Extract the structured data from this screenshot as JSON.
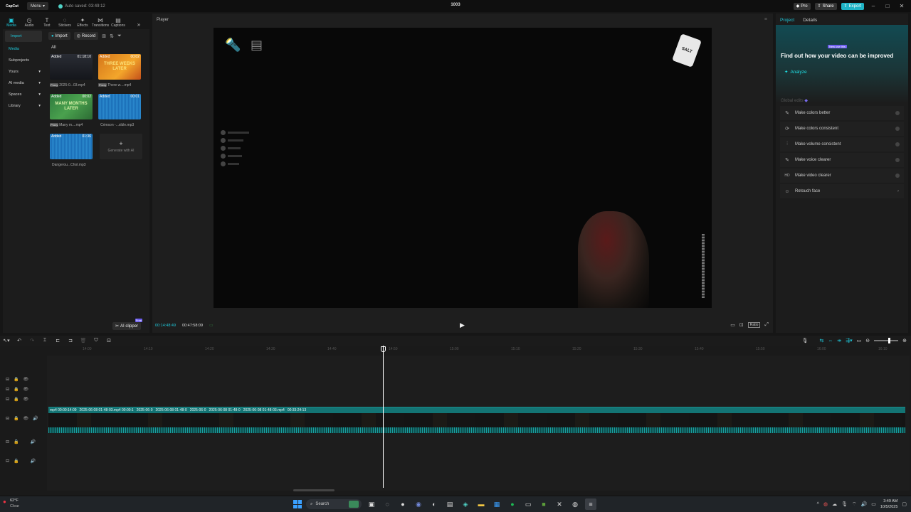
{
  "titlebar": {
    "logo": "CapCut",
    "menu_label": "Menu",
    "autosave": "Auto saved: 03:49:12",
    "project_name": "1003",
    "pro_label": "Pro",
    "share_label": "Share",
    "export_label": "Export"
  },
  "left_tabs": [
    {
      "label": "Media",
      "icon": "▣"
    },
    {
      "label": "Audio",
      "icon": "◷"
    },
    {
      "label": "Text",
      "icon": "T"
    },
    {
      "label": "Stickers",
      "icon": "◌"
    },
    {
      "label": "Effects",
      "icon": "✦"
    },
    {
      "label": "Transitions",
      "icon": "⋈"
    },
    {
      "label": "Captions",
      "icon": "▤"
    }
  ],
  "media": {
    "side_nav": {
      "import": "Import",
      "media": "Media",
      "subprojects": "Subprojects",
      "yours": "Yours",
      "ai_media": "AI media",
      "spaces": "Spaces",
      "library": "Library"
    },
    "import_btn": "Import",
    "record_btn": "Record",
    "all_label": "All",
    "clips": [
      {
        "tag": "Added",
        "duration": "01:18:10",
        "name": "2025-0...03.mp4",
        "badge": "Proxy"
      },
      {
        "tag": "Added",
        "duration": "00:02",
        "name": "There w....mp4",
        "badge": "Proxy",
        "thumb_text": "THREE WEEKS LATER"
      },
      {
        "tag": "Added",
        "duration": "00:02",
        "name": "Many m....mp4",
        "badge": "Proxy",
        "thumb_text": "MANY MONTHS LATER"
      },
      {
        "tag": "Added",
        "duration": "00:01",
        "name": "Crimson -...xible.mp3",
        "badge": ""
      },
      {
        "tag": "Added",
        "duration": "01:36",
        "name": "Dangerou...Chol.mp3",
        "badge": ""
      }
    ],
    "generate_ai": "Generate with AI",
    "ai_clipper": "AI clipper",
    "ai_clipper_badge": "Free"
  },
  "player": {
    "label": "Player",
    "current_time": "00:14:48:49",
    "total_time": "00:47:58:09",
    "ratio_label": "Ratio",
    "salt_label": "SALT"
  },
  "right_panel": {
    "tab_project": "Project",
    "tab_details": "Details",
    "badge": "New use this",
    "hero_text": "Find out how your video can be improved",
    "analyze": "Analyze",
    "global_edits": "Global edits",
    "items": [
      {
        "label": "Make colors better",
        "icon": "✎",
        "type": "toggle"
      },
      {
        "label": "Make colors consistent",
        "icon": "⟳",
        "type": "toggle"
      },
      {
        "label": "Make volume consistent",
        "icon": "⫶",
        "type": "toggle"
      },
      {
        "label": "Make voice clearer",
        "icon": "✎",
        "type": "toggle"
      },
      {
        "label": "Make video clearer",
        "icon": "HD",
        "type": "toggle"
      },
      {
        "label": "Retouch face",
        "icon": "☺",
        "type": "chevron"
      }
    ]
  },
  "timeline": {
    "ruler_ticks": [
      "14:00",
      "14:10",
      "14:20",
      "14:30",
      "14:40",
      "14:50",
      "15:00",
      "15:10",
      "15:20",
      "15:30",
      "15:40",
      "15:50",
      "16:00",
      "16:10"
    ],
    "clip_labels": [
      "mp4  00:00:14:09",
      "2025-06-08 01-48-03.mp4  00:00:1",
      "2025-06-0",
      "2025-06-08 01-48-0",
      "2025-06-0",
      "2025-06-08 01-48-0",
      "2025-06-08 01-48-03.mp4",
      "00:33:24:13"
    ]
  },
  "taskbar": {
    "temp": "62°F",
    "condition": "Clear",
    "search": "Search",
    "time": "3:49 AM",
    "date": "10/5/2025"
  },
  "colors": {
    "accent": "#1fc6d8",
    "export": "#1fb4c6",
    "clip_teal": "#137474"
  }
}
